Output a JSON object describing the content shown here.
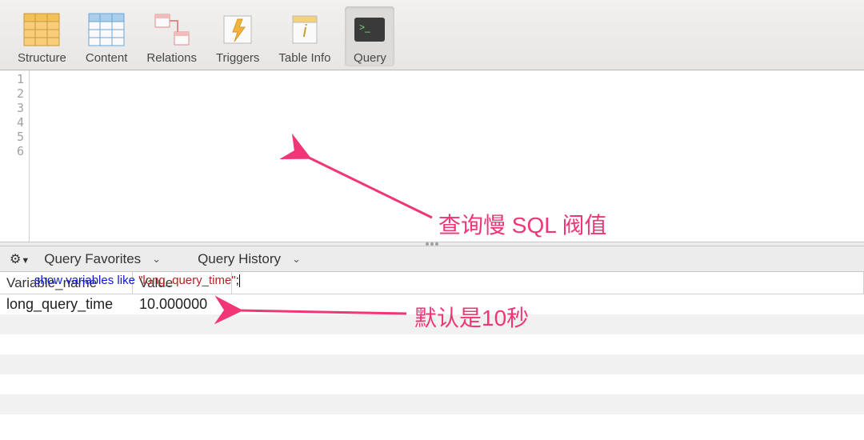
{
  "toolbar": {
    "items": [
      {
        "label": "Structure",
        "icon": "structure"
      },
      {
        "label": "Content",
        "icon": "content"
      },
      {
        "label": "Relations",
        "icon": "relations"
      },
      {
        "label": "Triggers",
        "icon": "triggers"
      },
      {
        "label": "Table Info",
        "icon": "tableinfo"
      },
      {
        "label": "Query",
        "icon": "query",
        "selected": true
      }
    ]
  },
  "editor": {
    "lines": [
      "1",
      "2",
      "3",
      "4",
      "5",
      "6"
    ],
    "sql": {
      "kw1": "show",
      "kw2": "variables",
      "kw3": "like",
      "str": "\"long_query_time\"",
      "tail": ";"
    }
  },
  "result_toolbar": {
    "favorites_label": "Query Favorites",
    "history_label": "Query History"
  },
  "result": {
    "columns": {
      "c1": "Variable_name",
      "c2": "Value"
    },
    "row": {
      "name": "long_query_time",
      "value": "10.000000"
    }
  },
  "annotations": {
    "a1": "查询慢 SQL 阀值",
    "a2": "默认是10秒"
  }
}
